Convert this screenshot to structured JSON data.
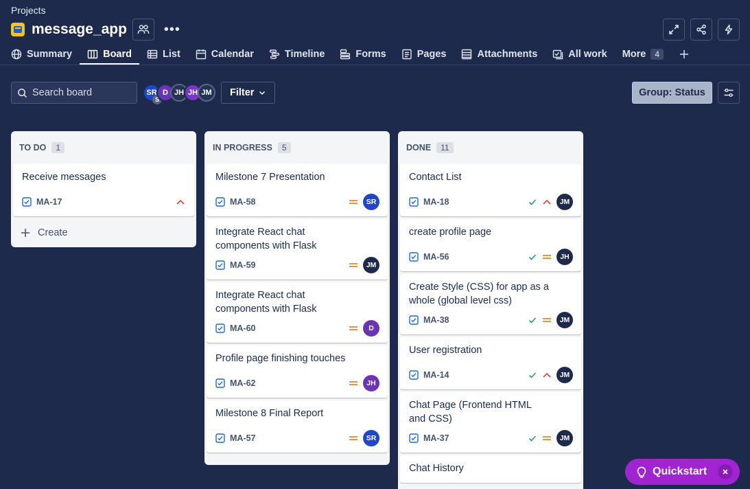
{
  "breadcrumb": "Projects",
  "project": {
    "name": "message_app"
  },
  "tabs": [
    {
      "label": "Summary",
      "icon": "globe-icon"
    },
    {
      "label": "Board",
      "icon": "board-icon",
      "active": true
    },
    {
      "label": "List",
      "icon": "list-icon"
    },
    {
      "label": "Calendar",
      "icon": "calendar-icon"
    },
    {
      "label": "Timeline",
      "icon": "timeline-icon"
    },
    {
      "label": "Forms",
      "icon": "forms-icon"
    },
    {
      "label": "Pages",
      "icon": "pages-icon"
    },
    {
      "label": "Attachments",
      "icon": "attachments-icon"
    },
    {
      "label": "All work",
      "icon": "all-work-icon"
    }
  ],
  "more_tab": {
    "label": "More",
    "count": "4"
  },
  "toolbar": {
    "search_placeholder": "Search board",
    "filter_label": "Filter",
    "group_label": "Group: Status",
    "avatars": [
      {
        "initials": "SR",
        "color": "#1f46c8",
        "sub": "S"
      },
      {
        "initials": "D",
        "color": "#6a35b5"
      },
      {
        "initials": "JH",
        "color": "#253355"
      },
      {
        "initials": "JH",
        "color": "#7a36c2"
      },
      {
        "initials": "JM",
        "color": "#253355"
      }
    ]
  },
  "colors": {
    "avatar_SR": "#1f46c8",
    "avatar_JM": "#1d2a4c",
    "avatar_JH": "#6e34b8",
    "avatar_D": "#6a35b5",
    "priority_high": "#e2483d",
    "priority_medium": "#e8822b",
    "done_check": "#22a06b",
    "checkbox": "#1868db"
  },
  "columns": [
    {
      "name": "TO DO",
      "count": "1",
      "create_label": "Create",
      "cards": [
        {
          "title": "Receive messages",
          "key": "MA-17",
          "priority": "high",
          "done": false,
          "assignee": ""
        }
      ]
    },
    {
      "name": "IN PROGRESS",
      "count": "5",
      "cards": [
        {
          "title": "Milestone 7 Presentation",
          "key": "MA-58",
          "priority": "medium",
          "done": false,
          "assignee": "SR"
        },
        {
          "title": "Integrate React chat components with Flask",
          "key": "MA-59",
          "priority": "medium",
          "done": false,
          "assignee": "JM"
        },
        {
          "title": "Integrate React chat components with Flask",
          "key": "MA-60",
          "priority": "medium",
          "done": false,
          "assignee": "D"
        },
        {
          "title": "Profile page finishing touches",
          "key": "MA-62",
          "priority": "medium",
          "done": false,
          "assignee": "JH"
        },
        {
          "title": "Milestone 8 Final Report",
          "key": "MA-57",
          "priority": "medium",
          "done": false,
          "assignee": "SR"
        }
      ]
    },
    {
      "name": "DONE",
      "count": "11",
      "cards": [
        {
          "title": "Contact List",
          "key": "MA-18",
          "priority": "high",
          "done": true,
          "assignee": "JM"
        },
        {
          "title": "create profile page",
          "key": "MA-56",
          "priority": "medium",
          "done": true,
          "assignee": "JH"
        },
        {
          "title": "Create Style (CSS) for app as a whole (global level css)",
          "key": "MA-38",
          "priority": "medium",
          "done": true,
          "assignee": "JM"
        },
        {
          "title": "User registration",
          "key": "MA-14",
          "priority": "high",
          "done": true,
          "assignee": "JM"
        },
        {
          "title": "Chat Page (Frontend HTML and CSS)",
          "key": "MA-37",
          "priority": "medium",
          "done": true,
          "assignee": "JM"
        },
        {
          "title": "Chat History",
          "key": "",
          "priority": "",
          "done": true,
          "assignee": ""
        }
      ]
    }
  ],
  "quickstart": {
    "label": "Quickstart"
  }
}
